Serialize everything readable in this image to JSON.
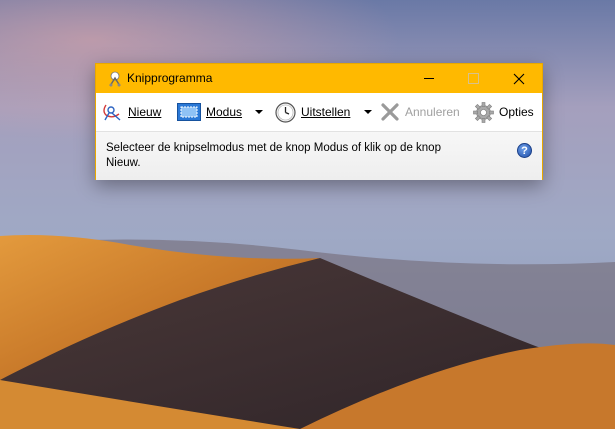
{
  "window": {
    "title": "Knipprogramma",
    "accent_color": "#ffb900",
    "icons": {
      "app": "scissors-icon",
      "minimize": "minimize-icon",
      "maximize": "maximize-icon",
      "close": "close-icon"
    }
  },
  "toolbar": {
    "new": {
      "label": "Nieuw",
      "icon": "new-snip-icon"
    },
    "mode": {
      "label": "Modus",
      "icon": "rectangle-mode-icon"
    },
    "delay": {
      "label": "Uitstellen",
      "icon": "clock-icon"
    },
    "cancel": {
      "label": "Annuleren",
      "icon": "x-icon",
      "disabled": true
    },
    "options": {
      "label": "Opties",
      "icon": "gear-icon"
    }
  },
  "status": {
    "message": "Selecteer de knipselmodus met de knop Modus of klik op de knop Nieuw.",
    "help_glyph": "?"
  },
  "desktop": {
    "wallpaper": "desert-dunes"
  }
}
